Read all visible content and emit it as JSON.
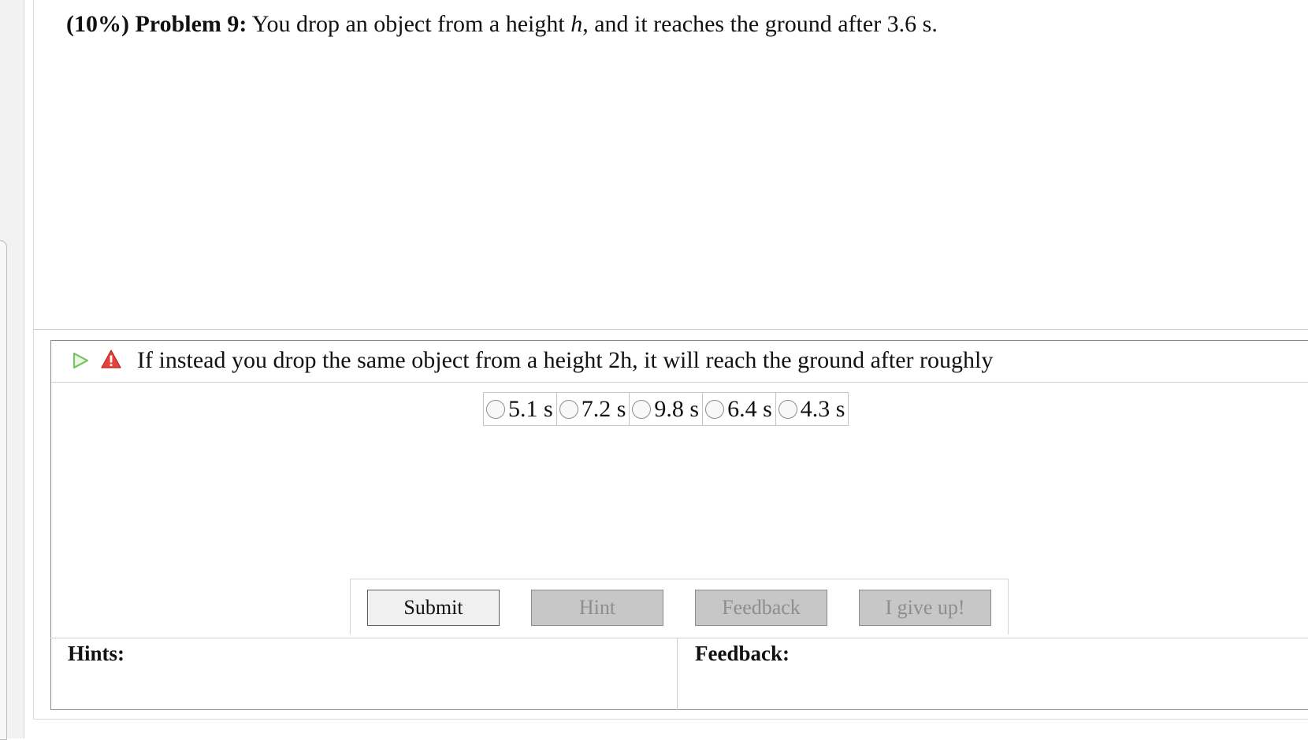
{
  "problem": {
    "percent": "(10%)",
    "label": "Problem 9:",
    "text_before": "You drop an object from a height ",
    "variable": "h",
    "text_after": ", and it reaches the ground after 3.6 s."
  },
  "question": {
    "text": "If instead you drop the same object from a height 2h, it will reach the ground after roughly",
    "choices": [
      "5.1 s",
      "7.2 s",
      "9.8 s",
      "6.4 s",
      "4.3 s"
    ]
  },
  "buttons": {
    "submit": "Submit",
    "hint": "Hint",
    "feedback": "Feedback",
    "give_up": "I give up!"
  },
  "hints_label": "Hints:",
  "feedback_label": "Feedback:",
  "icons": {
    "play": "play-triangle-icon",
    "warning": "warning-icon"
  },
  "colors": {
    "play_icon": "#7cc26b",
    "warning_icon": "#d9362f",
    "disabled_button": "#c7c7c7"
  }
}
